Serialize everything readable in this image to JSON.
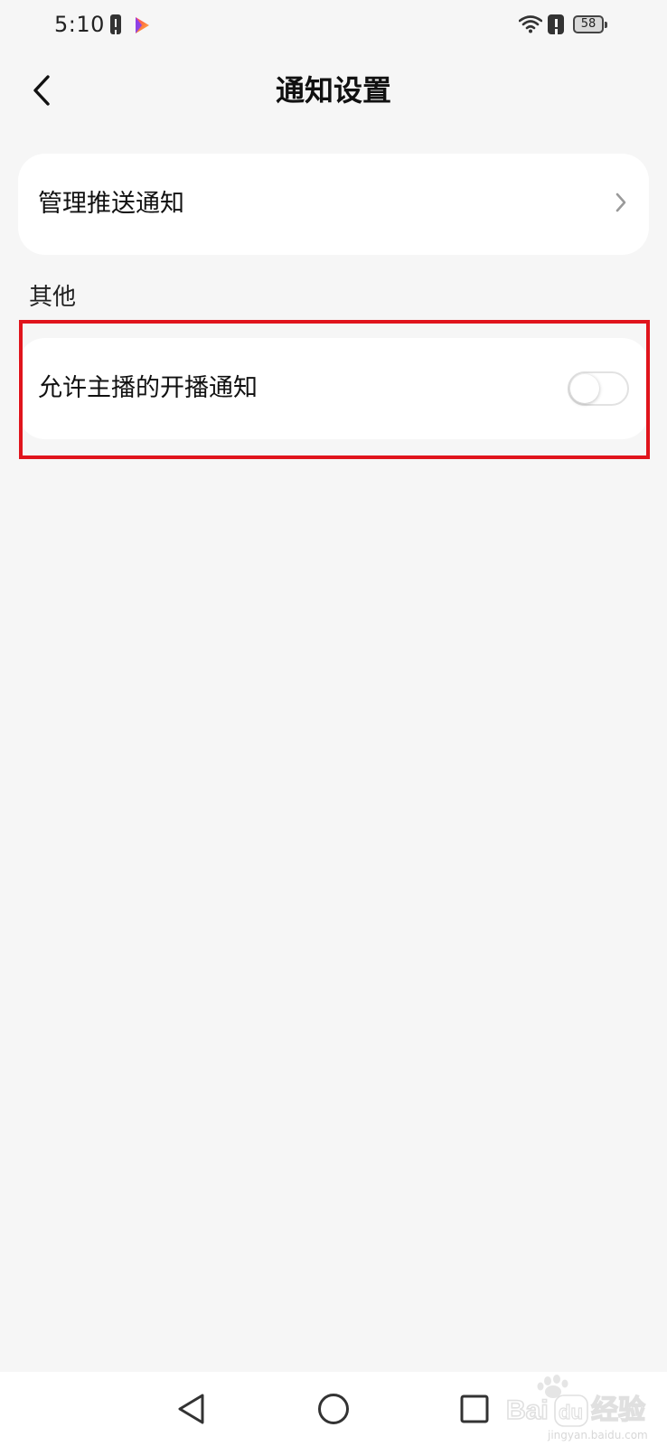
{
  "status_bar": {
    "time": "5:10",
    "battery_level": "58",
    "icons": [
      "alert-icon",
      "video-app-icon",
      "wifi-icon",
      "alert-icon",
      "battery-icon"
    ]
  },
  "header": {
    "title": "通知设置",
    "back_icon": "chevron-left-icon"
  },
  "manage_push": {
    "label": "管理推送通知",
    "icon": "chevron-right-icon"
  },
  "other_section": {
    "title": "其他",
    "live_notification": {
      "label": "允许主播的开播通知",
      "enabled": false
    }
  },
  "highlight_color": "#e0141c",
  "watermark": {
    "brand": "Bai",
    "brand_suffix": "经验",
    "url": "jingyan.baidu.com"
  },
  "nav_bar": {
    "icons": [
      "back-triangle-icon",
      "home-circle-icon",
      "recents-square-icon"
    ]
  }
}
